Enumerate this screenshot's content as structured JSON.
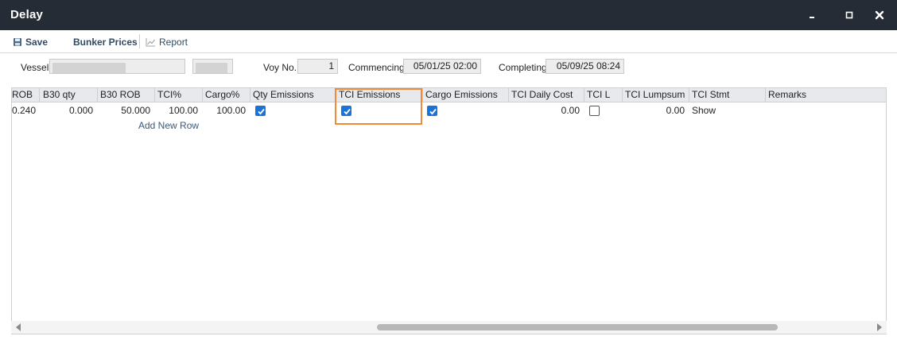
{
  "window": {
    "title": "Delay"
  },
  "toolbar": {
    "save_label": "Save",
    "bunker_label": "Bunker Prices",
    "report_label": "Report"
  },
  "form": {
    "vessel_label": "Vessel",
    "voy_label": "Voy No.",
    "voy_value": "1",
    "commencing_label": "Commencing",
    "commencing_value": "05/01/25 02:00",
    "completing_label": "Completing",
    "completing_value": "05/09/25 08:24"
  },
  "grid": {
    "headers": {
      "rob": "ROB",
      "b30qty": "B30 qty",
      "b30rob": "B30 ROB",
      "tci_pct": "TCI%",
      "cargo_pct": "Cargo%",
      "qty_em": "Qty Emissions",
      "tci_em": "TCI Emissions",
      "cargo_em": "Cargo Emissions",
      "tci_daily": "TCI Daily Cost",
      "tci_l": "TCI L",
      "tci_lump": "TCI Lumpsum",
      "tci_stmt": "TCI Stmt",
      "remarks": "Remarks"
    },
    "row": {
      "rob": "0.240",
      "b30qty": "0.000",
      "b30rob": "50.000",
      "tci_pct": "100.00",
      "cargo_pct": "100.00",
      "qty_em": true,
      "tci_em": true,
      "cargo_em": true,
      "tci_daily": "0.00",
      "tci_l": false,
      "tci_lump": "0.00",
      "tci_stmt": "Show",
      "remarks": ""
    },
    "add_row_label": "Add New Row"
  },
  "colors": {
    "titlebar": "#252c35",
    "highlight": "#ef8a3a",
    "checkbox_checked": "#1a73d9"
  }
}
